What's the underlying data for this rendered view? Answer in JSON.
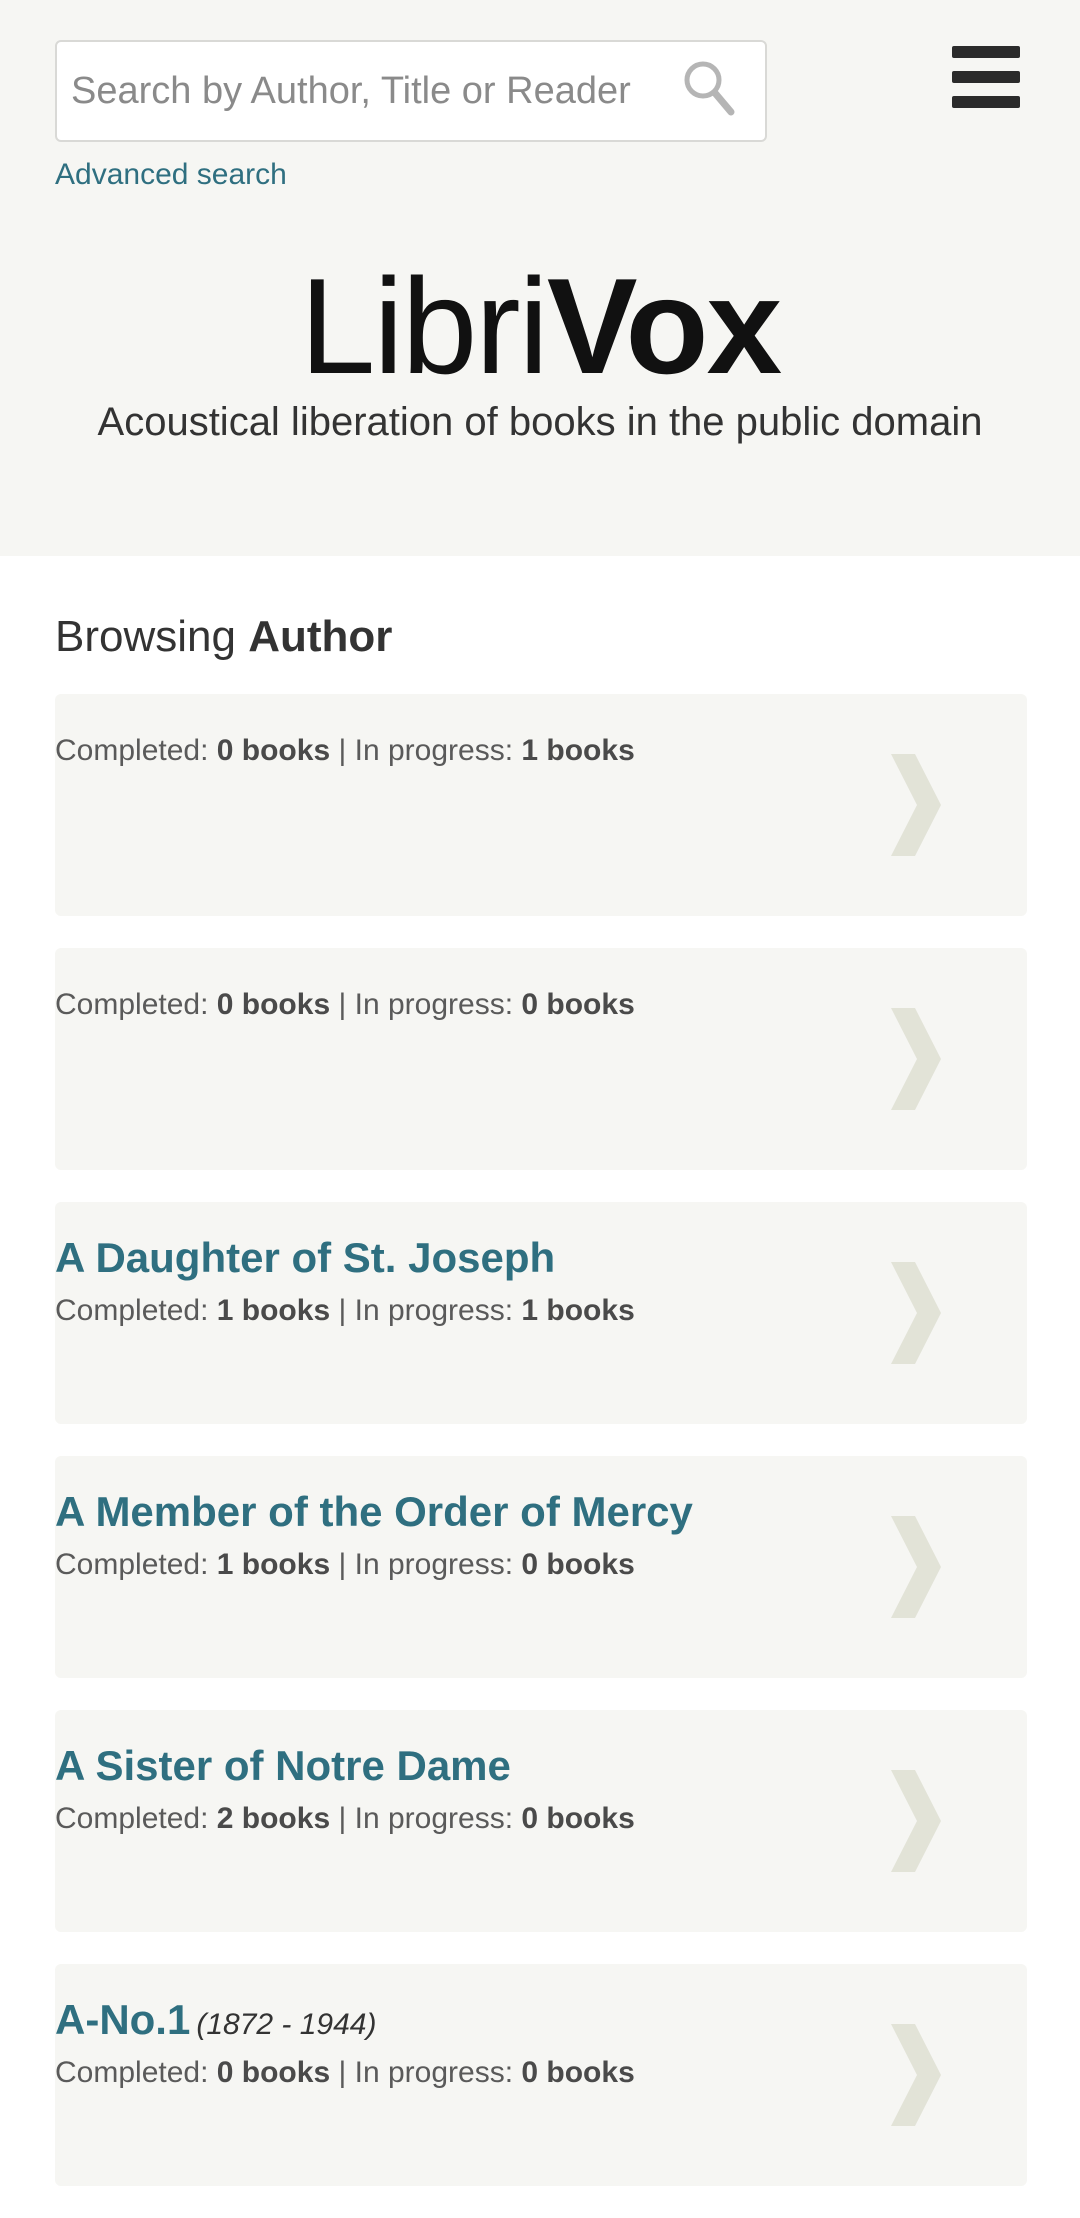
{
  "search": {
    "placeholder": "Search by Author, Title or Reader",
    "icon": "search-icon",
    "advanced_label": "Advanced search"
  },
  "menu": {
    "icon": "hamburger-menu-icon"
  },
  "logo": {
    "part1": "Libri",
    "part2": "Vox"
  },
  "tagline": "Acoustical liberation of books in the public domain",
  "browse": {
    "prefix": "Browsing",
    "category": "Author"
  },
  "labels": {
    "completed": "Completed:",
    "separator": "|",
    "in_progress": "In progress:"
  },
  "authors": [
    {
      "name": "",
      "dates": "",
      "completed": "0 books",
      "in_progress": "1 books"
    },
    {
      "name": "",
      "dates": "",
      "completed": "0 books",
      "in_progress": "0 books"
    },
    {
      "name": "A Daughter of St. Joseph",
      "dates": "",
      "completed": "1 books",
      "in_progress": "1 books"
    },
    {
      "name": "A Member of the Order of Mercy",
      "dates": "",
      "completed": "1 books",
      "in_progress": "0 books"
    },
    {
      "name": "A Sister of Notre Dame",
      "dates": "",
      "completed": "2 books",
      "in_progress": "0 books"
    },
    {
      "name": "A-No.1",
      "dates": "(1872 - 1944)",
      "completed": "0 books",
      "in_progress": "0 books"
    }
  ],
  "colors": {
    "header_bg": "#f6f6f3",
    "card_bg": "#f6f6f3",
    "link": "#2f6f80",
    "chevron": "#e2e3d7",
    "text": "#333333"
  }
}
